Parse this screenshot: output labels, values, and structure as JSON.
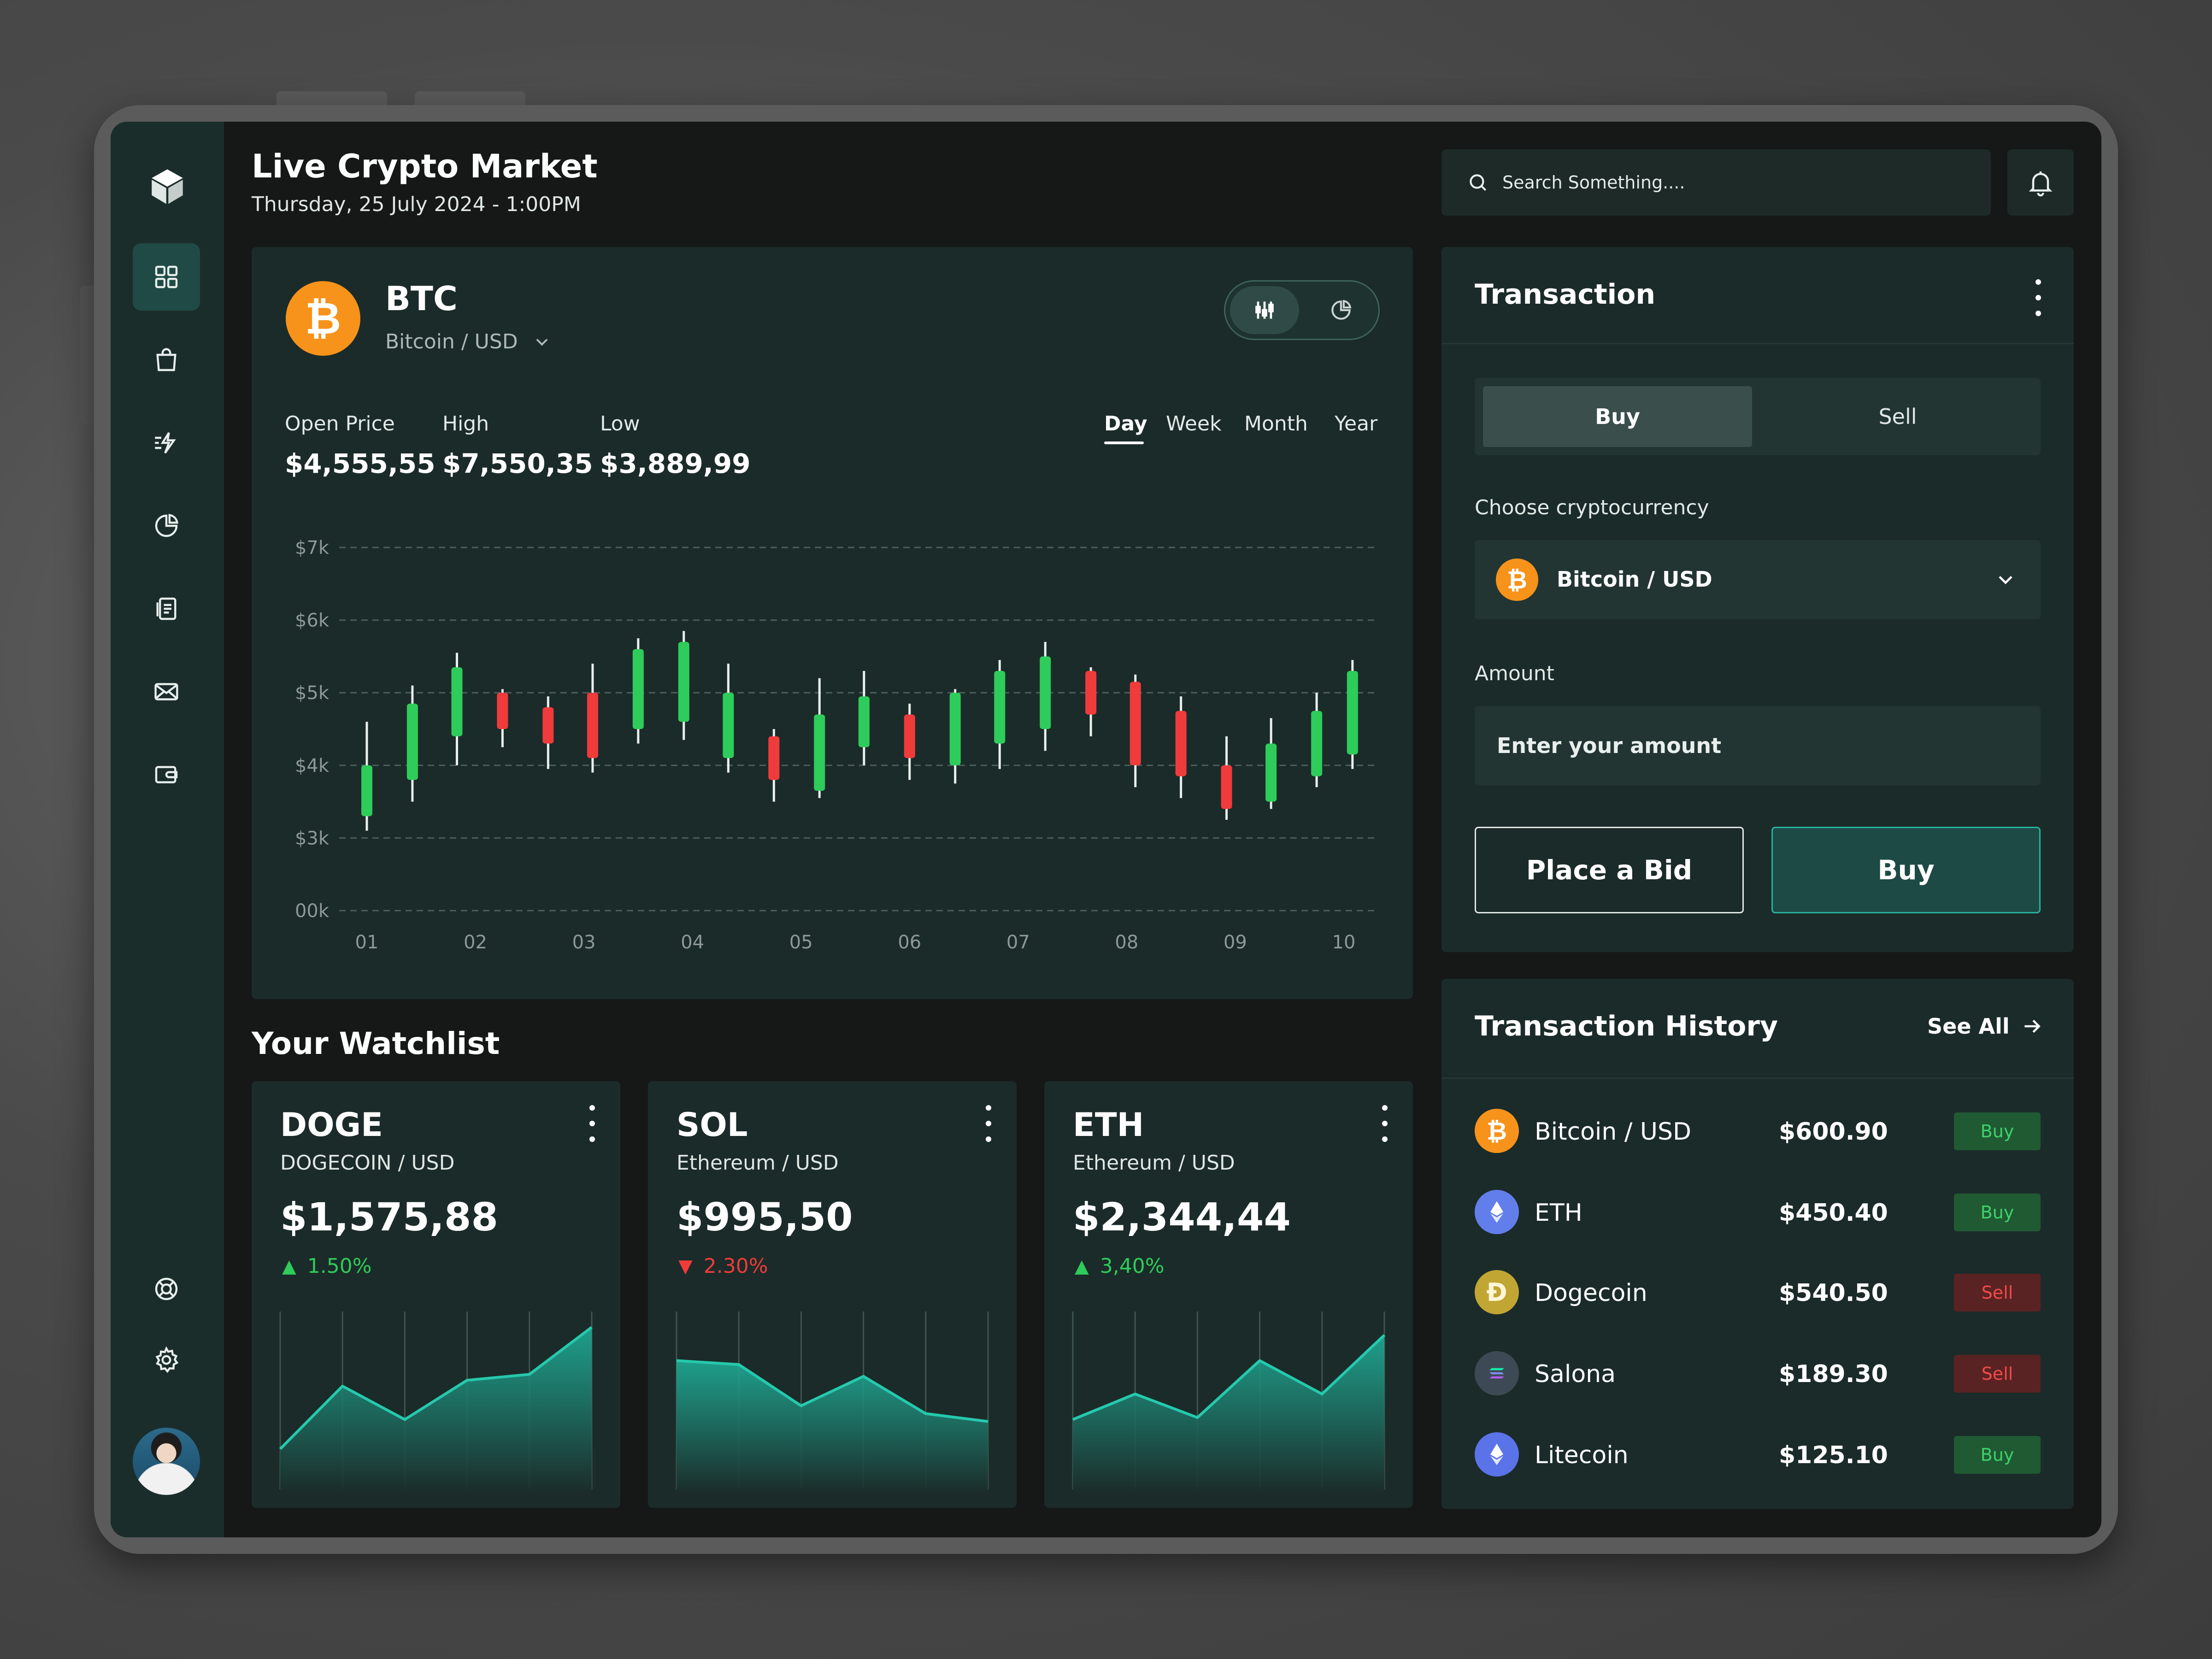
{
  "header": {
    "title": "Live Crypto Market",
    "date": "Thursday, 25 July 2024 - 1:00PM",
    "search_placeholder": "Search Something...."
  },
  "sidebar": {
    "items": [
      {
        "name": "dashboard",
        "icon": "grid-icon",
        "active": true
      },
      {
        "name": "market",
        "icon": "shopping-bag-icon",
        "active": false
      },
      {
        "name": "trade",
        "icon": "lightning-icon",
        "active": false
      },
      {
        "name": "analytics",
        "icon": "pie-chart-icon",
        "active": false
      },
      {
        "name": "reports",
        "icon": "document-icon",
        "active": false
      },
      {
        "name": "messages",
        "icon": "mail-icon",
        "active": false
      },
      {
        "name": "wallet",
        "icon": "wallet-icon",
        "active": false
      }
    ],
    "bottom": [
      {
        "name": "support",
        "icon": "lifebuoy-icon"
      },
      {
        "name": "settings",
        "icon": "gear-icon"
      }
    ]
  },
  "btc": {
    "symbol": "BTC",
    "pair": "Bitcoin / USD",
    "stats": [
      {
        "label": "Open Price",
        "value": "$4,555,55"
      },
      {
        "label": "High",
        "value": "$7,550,35"
      },
      {
        "label": "Low",
        "value": "$3,889,99"
      }
    ],
    "periods": [
      "Day",
      "Week",
      "Month",
      "Year"
    ],
    "active_period": "Day"
  },
  "chart_data": {
    "type": "candlestick",
    "x": [
      "01",
      "02",
      "03",
      "04",
      "05",
      "06",
      "07",
      "08",
      "09",
      "10"
    ],
    "y_ticks": [
      "$7k",
      "$6k",
      "$5k",
      "$4k",
      "$3k",
      "00k"
    ],
    "ylim": [
      2,
      7
    ],
    "grid": true,
    "up_color": "#2ecc5a",
    "down_color": "#ef3b3b",
    "candles": [
      {
        "x": 1.0,
        "open": 3.3,
        "close": 4.0,
        "high": 4.6,
        "low": 3.1
      },
      {
        "x": 1.42,
        "open": 3.8,
        "close": 4.85,
        "high": 5.1,
        "low": 3.5
      },
      {
        "x": 1.83,
        "open": 4.4,
        "close": 5.35,
        "high": 5.55,
        "low": 4.0
      },
      {
        "x": 2.25,
        "open": 5.0,
        "close": 4.5,
        "high": 5.05,
        "low": 4.25
      },
      {
        "x": 2.67,
        "open": 4.8,
        "close": 4.3,
        "high": 4.95,
        "low": 3.95
      },
      {
        "x": 3.08,
        "open": 5.0,
        "close": 4.1,
        "high": 5.4,
        "low": 3.9
      },
      {
        "x": 3.5,
        "open": 4.5,
        "close": 5.6,
        "high": 5.75,
        "low": 4.3
      },
      {
        "x": 3.92,
        "open": 4.6,
        "close": 5.7,
        "high": 5.85,
        "low": 4.35
      },
      {
        "x": 4.33,
        "open": 4.1,
        "close": 5.0,
        "high": 5.4,
        "low": 3.9
      },
      {
        "x": 4.75,
        "open": 4.4,
        "close": 3.8,
        "high": 4.5,
        "low": 3.5
      },
      {
        "x": 5.17,
        "open": 3.65,
        "close": 4.7,
        "high": 5.2,
        "low": 3.55
      },
      {
        "x": 5.58,
        "open": 4.25,
        "close": 4.95,
        "high": 5.3,
        "low": 4.0
      },
      {
        "x": 6.0,
        "open": 4.7,
        "close": 4.1,
        "high": 4.85,
        "low": 3.8
      },
      {
        "x": 6.42,
        "open": 4.0,
        "close": 5.0,
        "high": 5.05,
        "low": 3.75
      },
      {
        "x": 6.83,
        "open": 4.3,
        "close": 5.3,
        "high": 5.45,
        "low": 3.95
      },
      {
        "x": 7.25,
        "open": 4.5,
        "close": 5.5,
        "high": 5.7,
        "low": 4.2
      },
      {
        "x": 7.67,
        "open": 5.3,
        "close": 4.7,
        "high": 5.35,
        "low": 4.4
      },
      {
        "x": 8.08,
        "open": 5.15,
        "close": 4.0,
        "high": 5.25,
        "low": 3.7
      },
      {
        "x": 8.5,
        "open": 4.75,
        "close": 3.85,
        "high": 4.95,
        "low": 3.55
      },
      {
        "x": 8.92,
        "open": 4.0,
        "close": 3.4,
        "high": 4.4,
        "low": 3.25
      },
      {
        "x": 9.33,
        "open": 3.5,
        "close": 4.3,
        "high": 4.65,
        "low": 3.4
      },
      {
        "x": 9.75,
        "open": 3.85,
        "close": 4.75,
        "high": 5.0,
        "low": 3.7
      },
      {
        "x": 10.08,
        "open": 4.15,
        "close": 5.3,
        "high": 5.45,
        "low": 3.95
      }
    ]
  },
  "watchlist": {
    "title": "Your Watchlist",
    "items": [
      {
        "symbol": "DOGE",
        "pair": "DOGECOIN / USD",
        "price": "$1,575,88",
        "change": "1.50%",
        "direction": "up",
        "spark": [
          0.3,
          0.62,
          0.45,
          0.65,
          0.68,
          0.92
        ]
      },
      {
        "symbol": "SOL",
        "pair": "Ethereum / USD",
        "price": "$995,50",
        "change": "2.30%",
        "direction": "down",
        "spark": [
          0.75,
          0.73,
          0.52,
          0.67,
          0.48,
          0.44
        ]
      },
      {
        "symbol": "ETH",
        "pair": "Ethereum / USD",
        "price": "$2,344,44",
        "change": "3,40%",
        "direction": "up",
        "spark": [
          0.45,
          0.58,
          0.46,
          0.75,
          0.58,
          0.88
        ]
      }
    ]
  },
  "transaction": {
    "title": "Transaction",
    "tabs": [
      "Buy",
      "Sell"
    ],
    "choose_label": "Choose cryptocurrency",
    "selected": "Bitcoin / USD",
    "amount_label": "Amount",
    "amount_placeholder": "Enter your amount",
    "bid_label": "Place a Bid",
    "buy_label": "Buy"
  },
  "history": {
    "title": "Transaction History",
    "see_all": "See All",
    "rows": [
      {
        "name": "Bitcoin / USD",
        "amount": "$600.90",
        "type": "Buy",
        "coin_color": "#f7931a",
        "icon": "bitcoin-icon"
      },
      {
        "name": "ETH",
        "amount": "$450.40",
        "type": "Buy",
        "coin_color": "#627eea",
        "icon": "ethereum-icon"
      },
      {
        "name": "Dogecoin",
        "amount": "$540.50",
        "type": "Sell",
        "coin_color": "#c2a633",
        "icon": "dogecoin-icon"
      },
      {
        "name": "Salona",
        "amount": "$189.30",
        "type": "Sell",
        "coin_color": "#3d4a55",
        "icon": "solana-icon"
      },
      {
        "name": "Litecoin",
        "amount": "$125.10",
        "type": "Buy",
        "coin_color": "#5a73e8",
        "icon": "litecoin-icon"
      }
    ]
  }
}
